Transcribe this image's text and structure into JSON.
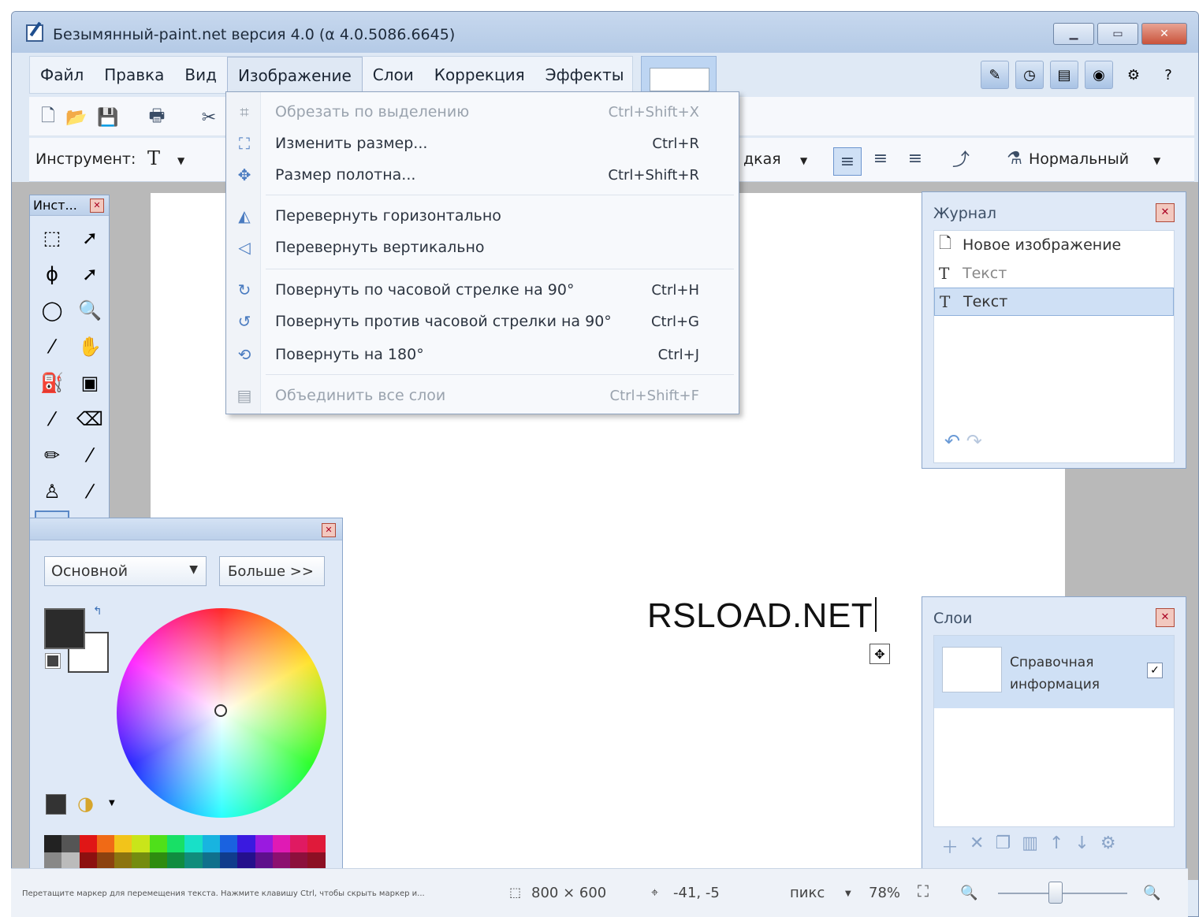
{
  "window": {
    "title": "Безымянный-paint.net версия 4.0 (α 4.0.5086.6645)"
  },
  "menubar": [
    "Файл",
    "Правка",
    "Вид",
    "Изображение",
    "Слои",
    "Коррекция",
    "Эффекты"
  ],
  "toolbar": {
    "tool_label": "Инструмент:",
    "tool_value": "T",
    "align_partial": "дкая",
    "blend_mode": "Нормальный"
  },
  "image_menu": {
    "items": [
      {
        "label": "Обрезать по выделению",
        "shortcut": "Ctrl+Shift+X",
        "icon": "crop-icon",
        "disabled": true
      },
      {
        "label": "Изменить размер...",
        "shortcut": "Ctrl+R",
        "icon": "resize-icon",
        "disabled": false
      },
      {
        "label": "Размер полотна...",
        "shortcut": "Ctrl+Shift+R",
        "icon": "canvas-size-icon",
        "disabled": false
      },
      {
        "label": "Перевернуть горизонтально",
        "shortcut": "",
        "icon": "flip-horizontal-icon",
        "disabled": false
      },
      {
        "label": "Перевернуть вертикально",
        "shortcut": "",
        "icon": "flip-vertical-icon",
        "disabled": false
      },
      {
        "label": "Повернуть по часовой стрелке на 90°",
        "shortcut": "Ctrl+H",
        "icon": "rotate-cw-icon",
        "disabled": false
      },
      {
        "label": "Повернуть против часовой стрелки на 90°",
        "shortcut": "Ctrl+G",
        "icon": "rotate-ccw-icon",
        "disabled": false
      },
      {
        "label": "Повернуть на 180°",
        "shortcut": "Ctrl+J",
        "icon": "rotate-180-icon",
        "disabled": false
      },
      {
        "label": "Объединить все слои",
        "shortcut": "Ctrl+Shift+F",
        "icon": "flatten-icon",
        "disabled": true
      }
    ]
  },
  "canvas": {
    "text": "RSLOAD.NET"
  },
  "toolbox": {
    "title": "Инст..."
  },
  "colors": {
    "mode": "Основной",
    "more_button": "Больше >>",
    "primary_color": "#2b2b2b",
    "secondary_color": "#ffffff"
  },
  "history": {
    "title": "Журнал",
    "items": [
      "Новое изображение",
      "Текст",
      "Текст"
    ]
  },
  "layers": {
    "title": "Слои",
    "layer_name_line1": "Справочная",
    "layer_name_line2": "информация"
  },
  "status": {
    "hint": "Перетащите маркер для перемещения текста. Нажмите клавишу Ctrl, чтобы скрыть маркер и...",
    "image_size": "800 × 600",
    "cursor_pos": "-41, -5",
    "units": "пикс",
    "zoom": "78%"
  }
}
